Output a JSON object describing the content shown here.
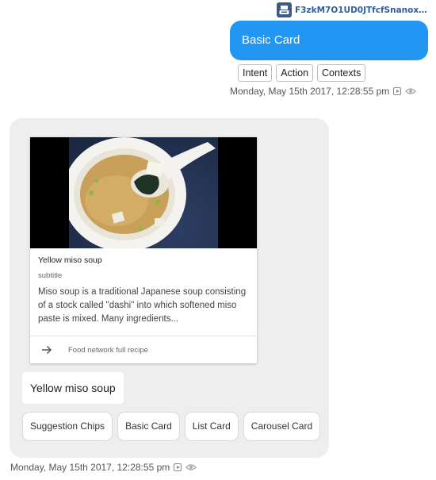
{
  "header": {
    "user_id": "F3zkM7O1UD0JTfcfSnanoxhyGSK...",
    "avatar_icon": "user-avatar-icon"
  },
  "user_message": {
    "text": "Basic Card",
    "bubble_color": "#2196f3",
    "tags": [
      {
        "label": "Intent"
      },
      {
        "label": "Action"
      },
      {
        "label": "Contexts"
      }
    ],
    "timestamp": "Monday, May 15th 2017, 12:28:55 pm"
  },
  "bot_response": {
    "card": {
      "image_alt": "miso soup bowl",
      "title": "Yellow miso soup",
      "subtitle": "subtitle",
      "description": "Miso soup is a traditional Japanese soup consisting of a stock called \"dashi\" into which softened miso paste is mixed. Many ingredients...",
      "link_text": "Food network full recipe",
      "link_icon": "arrow-right-icon"
    },
    "simple_response": "Yellow miso soup",
    "chips": [
      {
        "label": "Suggestion Chips"
      },
      {
        "label": "Basic Card"
      },
      {
        "label": "List Card"
      },
      {
        "label": "Carousel Card"
      }
    ],
    "timestamp": "Monday, May 15th 2017, 12:28:55 pm"
  }
}
